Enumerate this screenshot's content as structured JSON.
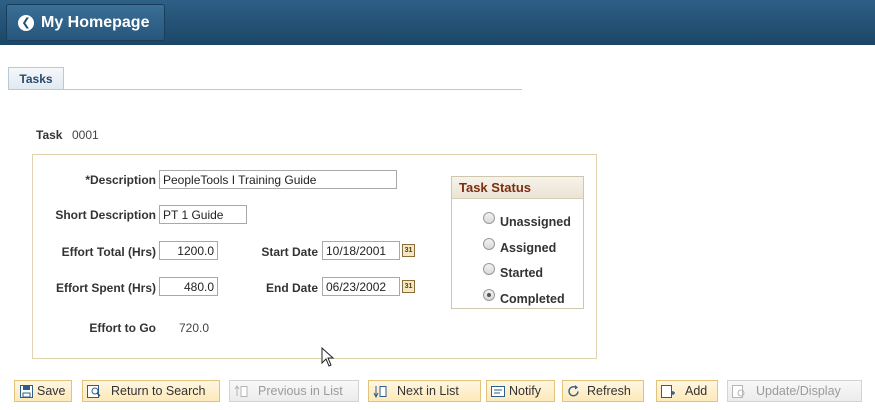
{
  "header": {
    "back_label": "My Homepage"
  },
  "tabs": [
    {
      "label": "Tasks"
    }
  ],
  "task": {
    "label": "Task",
    "value": "0001"
  },
  "form": {
    "description_label": "*Description",
    "description_value": "PeopleTools I Training Guide",
    "short_description_label": "Short Description",
    "short_description_value": "PT 1 Guide",
    "effort_total_label": "Effort Total (Hrs)",
    "effort_total_value": "1200.0",
    "start_date_label": "Start Date",
    "start_date_value": "10/18/2001",
    "effort_spent_label": "Effort Spent (Hrs)",
    "effort_spent_value": "480.0",
    "end_date_label": "End Date",
    "end_date_value": "06/23/2002",
    "effort_to_go_label": "Effort to Go",
    "effort_to_go_value": "720.0",
    "calendar_icon_text": "31"
  },
  "task_status": {
    "title": "Task Status",
    "options": [
      {
        "label": "Unassigned",
        "selected": false
      },
      {
        "label": "Assigned",
        "selected": false
      },
      {
        "label": "Started",
        "selected": false
      },
      {
        "label": "Completed",
        "selected": true
      }
    ]
  },
  "toolbar": {
    "save": "Save",
    "return_to_search": "Return to Search",
    "previous_in_list": "Previous in List",
    "next_in_list": "Next in List",
    "notify": "Notify",
    "refresh": "Refresh",
    "add": "Add",
    "update_display": "Update/Display"
  },
  "colors": {
    "header": "#1c4666",
    "status_title": "#7a2e12",
    "button_bg": "#fde9b8"
  }
}
